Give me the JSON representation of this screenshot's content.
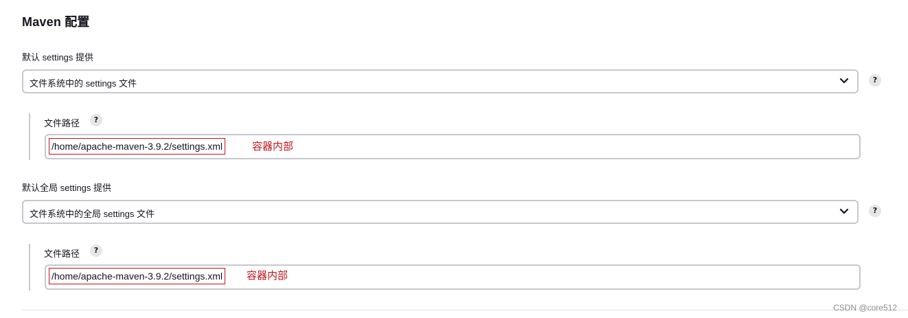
{
  "section": {
    "title": "Maven 配置"
  },
  "default_settings": {
    "label": "默认 settings 提供",
    "selected_option": "文件系统中的 settings 文件",
    "help": "?",
    "file_path": {
      "label": "文件路径",
      "help": "?",
      "value": "/home/apache-maven-3.9.2/settings.xml",
      "annotation": "容器内部"
    }
  },
  "global_settings": {
    "label": "默认全局 settings 提供",
    "selected_option": "文件系统中的全局 settings 文件",
    "help": "?",
    "file_path": {
      "label": "文件路径",
      "help": "?",
      "value": "/home/apache-maven-3.9.2/settings.xml",
      "annotation": "容器内部"
    }
  },
  "watermark": "CSDN @core512",
  "colors": {
    "annotation_red": "#c0141b",
    "border_gray": "#c6c8ce",
    "help_bg": "#e6e6e8"
  },
  "icons": {
    "select_chevron": "chevron-down-icon",
    "help": "help-icon"
  }
}
